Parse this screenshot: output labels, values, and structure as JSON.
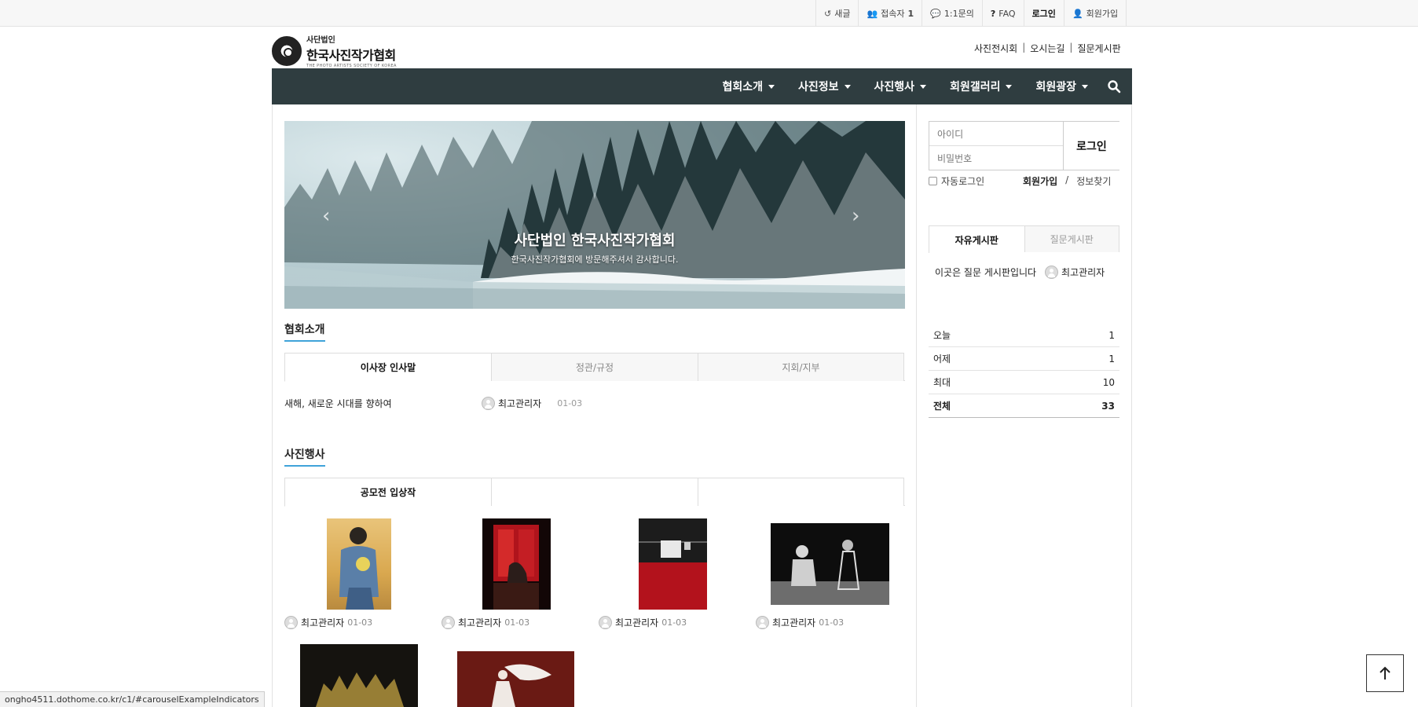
{
  "topbar": {
    "links": [
      {
        "icon": "history-icon",
        "label": "새글"
      },
      {
        "icon": "users-icon",
        "label": "접속자",
        "count": "1"
      },
      {
        "icon": "comments-icon",
        "label": "1:1문의"
      },
      {
        "icon": "question-icon",
        "label": "FAQ"
      },
      {
        "icon": "",
        "label": "로그인"
      },
      {
        "icon": "user-plus-icon",
        "label": "회원가입"
      }
    ]
  },
  "logo": {
    "line1": "사단법인",
    "line2": "한국사진작가협회",
    "line3": "THE PHOTO ARTISTS SOCIETY OF KOREA"
  },
  "header_links": [
    "사진전시회",
    "오시는길",
    "질문게시판"
  ],
  "nav": {
    "items": [
      "협회소개",
      "사진정보",
      "사진행사",
      "회원갤러리",
      "회원광장"
    ],
    "search_icon": "search-icon"
  },
  "carousel": {
    "title": "사단법인 한국사진작가협회",
    "subtitle": "한국사진작가협회에 방문해주셔서 감사합니다.",
    "prev": "‹",
    "next": "›"
  },
  "section_intro": {
    "title": "협회소개",
    "tabs": [
      "이사장 인사말",
      "정관/규정",
      "지회/지부"
    ],
    "post": {
      "title": "새해, 새로운 시대를 향하여",
      "author": "최고관리자",
      "date": "01-03"
    }
  },
  "section_event": {
    "title": "사진행사",
    "tabs": [
      "공모전 입상작",
      "",
      ""
    ],
    "items": [
      {
        "author": "최고관리자",
        "date": "01-03"
      },
      {
        "author": "최고관리자",
        "date": "01-03"
      },
      {
        "author": "최고관리자",
        "date": "01-03"
      },
      {
        "author": "최고관리자",
        "date": "01-03"
      }
    ]
  },
  "sidebar": {
    "login": {
      "id_placeholder": "아이디",
      "pw_placeholder": "비밀번호",
      "button": "로그인",
      "auto_login": "자동로그인",
      "join": "회원가입",
      "slash": "/",
      "find": "정보찾기"
    },
    "board_tabs": [
      "자유게시판",
      "질문게시판"
    ],
    "board_post": {
      "title": "이곳은 질문 게시판입니다",
      "author": "최고관리자"
    },
    "stats": [
      {
        "label": "오늘",
        "value": "1"
      },
      {
        "label": "어제",
        "value": "1"
      },
      {
        "label": "최대",
        "value": "10"
      },
      {
        "label": "전체",
        "value": "33"
      }
    ]
  },
  "status_url": "ongho4511.dothome.co.kr/c1/#carouselExampleIndicators",
  "to_top_icon": "arrow-up-icon"
}
